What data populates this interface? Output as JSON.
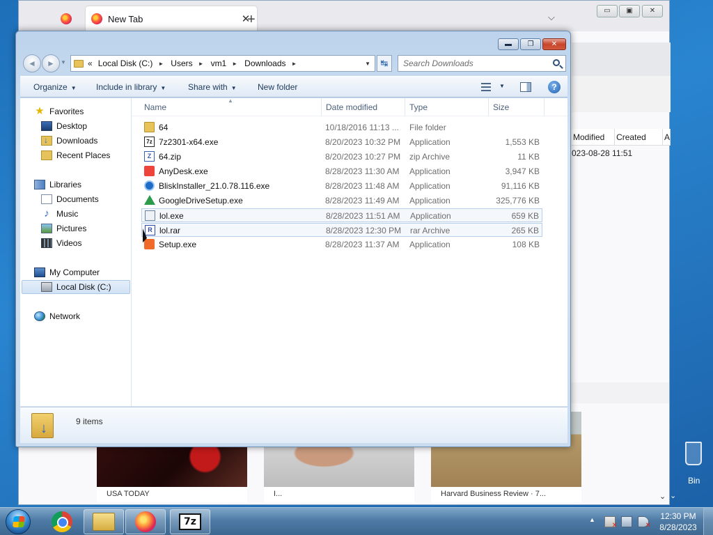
{
  "firefox": {
    "tab_label": "New Tab",
    "tab_close": "✕",
    "new_tab_btn": "+",
    "list_all_tabs": "⌵",
    "minimize": "▭",
    "maximize": "▣",
    "close": "✕",
    "list_headers": {
      "modified": "Modified",
      "created": "Created",
      "more": "A"
    },
    "list_row": {
      "modified": "023-08-28 11:51"
    },
    "news": [
      {
        "caption": "USA TODAY"
      },
      {
        "caption": "I..."
      },
      {
        "caption": "Harvard Business Review · 7..."
      }
    ]
  },
  "desktop": {
    "recycle_bin_label": "Bin"
  },
  "explorer": {
    "window_controls": {
      "minimize": "▬",
      "maximize": "❐",
      "close": "✕"
    },
    "nav": {
      "back": "◄",
      "forward": "►",
      "recent": "▼"
    },
    "address": {
      "chevrons": "«",
      "crumbs": [
        "Local Disk (C:)",
        "Users",
        "vm1",
        "Downloads"
      ],
      "separator": "►",
      "dropdown": "▼"
    },
    "refresh": "↹",
    "search": {
      "placeholder": "Search Downloads"
    },
    "toolbar": {
      "organize": "Organize",
      "include_in_library": "Include in library",
      "share_with": "Share with",
      "new_folder": "New folder",
      "caret": "▼",
      "help": "?"
    },
    "nav_pane": {
      "favorites": "Favorites",
      "desktop": "Desktop",
      "downloads": "Downloads",
      "recent_places": "Recent Places",
      "libraries": "Libraries",
      "documents": "Documents",
      "music": "Music",
      "pictures": "Pictures",
      "videos": "Videos",
      "my_computer": "My Computer",
      "local_disk": "Local Disk (C:)",
      "network": "Network"
    },
    "columns": {
      "name": "Name",
      "date_modified": "Date modified",
      "type": "Type",
      "size": "Size",
      "sort": "▲"
    },
    "files": [
      {
        "name": "64",
        "date": "10/18/2016 11:13 ...",
        "type": "File folder",
        "size": "",
        "icon": "folder-icon"
      },
      {
        "name": "7z2301-x64.exe",
        "date": "8/20/2023 10:32 PM",
        "type": "Application",
        "size": "1,553 KB",
        "icon": "7zip-icon",
        "glyph": "7z"
      },
      {
        "name": "64.zip",
        "date": "8/20/2023 10:27 PM",
        "type": "zip Archive",
        "size": "11 KB",
        "icon": "zip-icon",
        "glyph": "Z"
      },
      {
        "name": "AnyDesk.exe",
        "date": "8/28/2023 11:30 AM",
        "type": "Application",
        "size": "3,947 KB",
        "icon": "anydesk-icon"
      },
      {
        "name": "BliskInstaller_21.0.78.116.exe",
        "date": "8/28/2023 11:48 AM",
        "type": "Application",
        "size": "91,116 KB",
        "icon": "blisk-icon"
      },
      {
        "name": "GoogleDriveSetup.exe",
        "date": "8/28/2023 11:49 AM",
        "type": "Application",
        "size": "325,776 KB",
        "icon": "google-drive-icon"
      },
      {
        "name": "lol.exe",
        "date": "8/28/2023 11:51 AM",
        "type": "Application",
        "size": "659 KB",
        "icon": "exe-icon"
      },
      {
        "name": "lol.rar",
        "date": "8/28/2023 12:30 PM",
        "type": "rar Archive",
        "size": "265 KB",
        "icon": "rar-icon",
        "glyph": "R"
      },
      {
        "name": "Setup.exe",
        "date": "8/28/2023 11:37 AM",
        "type": "Application",
        "size": "108 KB",
        "icon": "setup-icon"
      }
    ],
    "details": {
      "count": "9 items"
    }
  },
  "taskbar": {
    "sevenzip_glyph": "7z",
    "tray_arrow": "▲",
    "clock_time": "12:30 PM",
    "clock_date": "8/28/2023"
  }
}
